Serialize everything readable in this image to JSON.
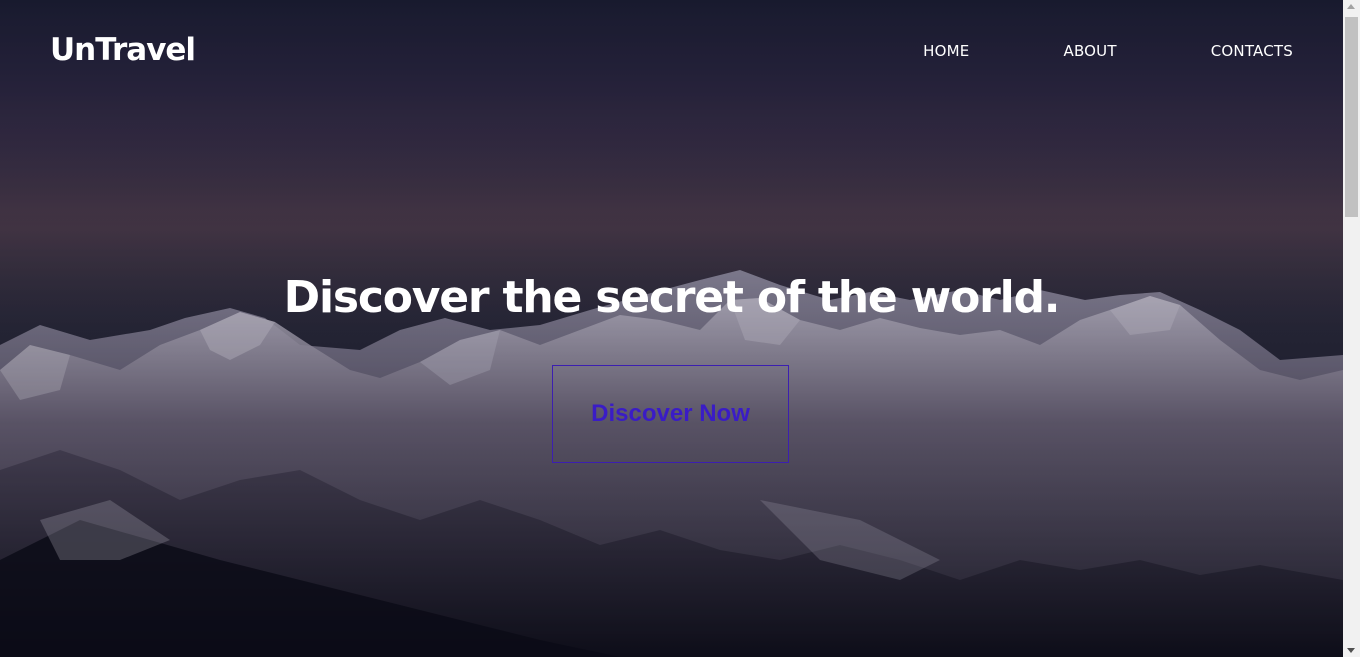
{
  "site": {
    "logo": "UnTravel"
  },
  "nav": {
    "items": [
      {
        "label": "HOME"
      },
      {
        "label": "ABOUT"
      },
      {
        "label": "CONTACTS"
      }
    ]
  },
  "hero": {
    "headline": "Discover the secret of the world.",
    "cta_label": "Discover Now",
    "background": "snowy-mountain-range-at-dusk"
  },
  "colors": {
    "text": "#ffffff",
    "cta_accent": "#3a1cc6",
    "sky_top": "#1c1e33",
    "sky_glow": "#4a3c4c"
  }
}
